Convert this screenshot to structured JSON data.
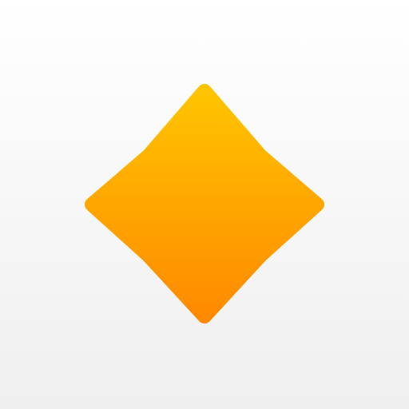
{
  "icon": {
    "name": "sparkle-icon",
    "background": {
      "top_color": "#ffffff",
      "bottom_color": "#efefef"
    },
    "shape": {
      "gradient_top": "#ffc400",
      "gradient_bottom": "#ff8a00"
    }
  }
}
